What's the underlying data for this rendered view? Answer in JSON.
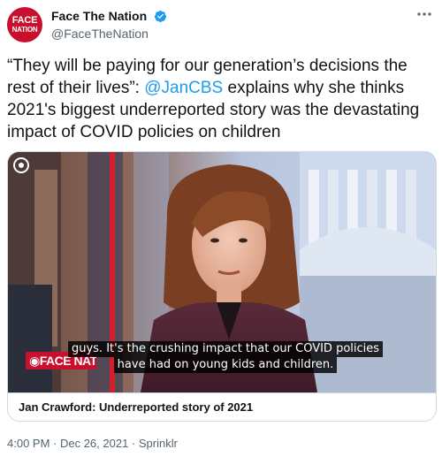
{
  "account": {
    "display_name": "Face The Nation",
    "handle": "@FaceTheNation",
    "avatar_line1": "FACE",
    "avatar_line2": "NATION",
    "verified": true
  },
  "tweet": {
    "text_before": "“They will be paying for our generation’s decisions the rest of their lives”: ",
    "mention": "@JanCBS",
    "text_after": " explains why she thinks 2021's biggest underreported story was the devastating impact of COVID policies on children"
  },
  "media": {
    "lower_third": "FACE NATION",
    "caption_line1": "guys. It's the crushing impact that our COVID policies",
    "caption_line2": "have had on young kids and children."
  },
  "card": {
    "title": "Jan Crawford: Underreported story of 2021"
  },
  "meta": {
    "text": "4:00 PM · Dec 26, 2021 · Sprinklr"
  },
  "colors": {
    "brand_red": "#c8102e",
    "link_blue": "#1d9bf0",
    "verified_blue": "#1d9bf0"
  }
}
